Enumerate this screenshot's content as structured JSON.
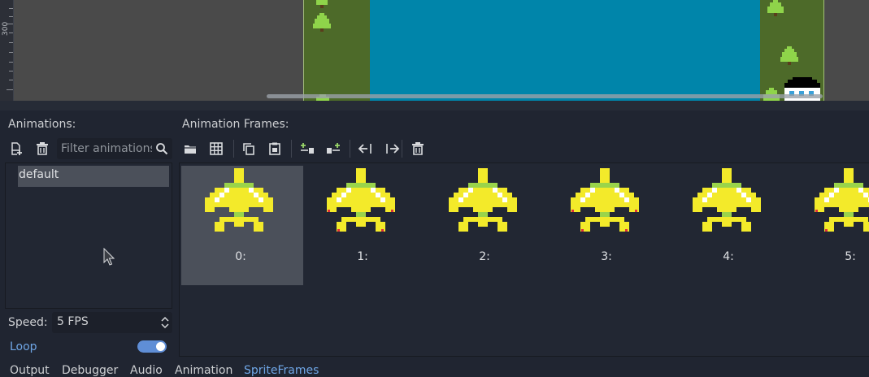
{
  "viewport": {
    "ruler_label": "300"
  },
  "animations_panel": {
    "title": "Animations:",
    "new_icon": "new-animation-icon",
    "delete_icon": "trash-icon",
    "filter_placeholder": "Filter animations",
    "filter_value": "",
    "items": [
      {
        "label": "default",
        "selected": true
      }
    ],
    "speed_label": "Speed:",
    "speed_value": "5 FPS",
    "loop_label": "Loop",
    "loop_enabled": true
  },
  "frames_panel": {
    "title": "Animation Frames:",
    "toolbar_icons": [
      "load-from-file-icon",
      "load-from-sprite-sheet-icon",
      "copy-icon",
      "paste-icon",
      "insert-before-icon",
      "insert-after-icon",
      "move-left-icon",
      "move-right-icon",
      "delete-frame-icon"
    ],
    "frames": [
      {
        "label": "0:",
        "selected": true
      },
      {
        "label": "1:",
        "selected": false
      },
      {
        "label": "2:",
        "selected": false
      },
      {
        "label": "3:",
        "selected": false
      },
      {
        "label": "4:",
        "selected": false
      },
      {
        "label": "5:",
        "selected": false
      }
    ]
  },
  "bottom_tabs": [
    {
      "label": "Output",
      "active": false
    },
    {
      "label": "Debugger",
      "active": false
    },
    {
      "label": "Audio",
      "active": false
    },
    {
      "label": "Animation",
      "active": false
    },
    {
      "label": "SpriteFrames",
      "active": true
    }
  ],
  "colors": {
    "accent": "#6fa6e6",
    "panel_bg": "#202531",
    "selection_bg": "#4b505a",
    "grass": "#4d6a29",
    "water": "#0085aa",
    "ship_yellow": "#f3ea2a",
    "ship_green": "#9ad44a"
  }
}
